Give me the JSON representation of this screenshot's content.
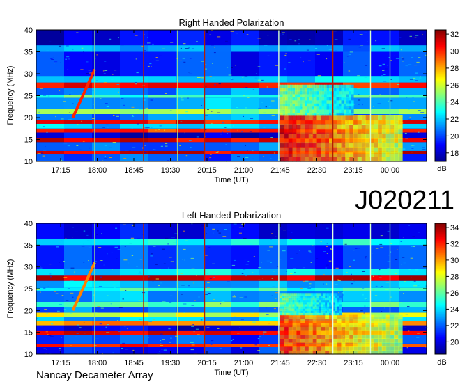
{
  "main_title": "J020211",
  "footer": "Nancay Decameter Array",
  "chart_data": [
    {
      "type": "heatmap",
      "title": "Right Handed Polarization",
      "xlabel": "Time (UT)",
      "ylabel": "Frequency (MHz)",
      "x_ticks": [
        "17:15",
        "18:00",
        "18:45",
        "19:30",
        "20:15",
        "21:00",
        "21:45",
        "22:30",
        "23:15",
        "00:00"
      ],
      "y_ticks": [
        10,
        15,
        20,
        25,
        30,
        35,
        40
      ],
      "ylim": [
        10,
        40
      ],
      "colorbar": {
        "ticks": [
          18,
          20,
          22,
          24,
          26,
          28,
          30,
          32
        ],
        "range": [
          17,
          32.5
        ],
        "label": "dB"
      },
      "bands": [
        {
          "f0": 10.0,
          "f1": 11.6,
          "level": 20.0
        },
        {
          "f0": 11.6,
          "f1": 12.4,
          "level": 31.0
        },
        {
          "f0": 12.4,
          "f1": 14.4,
          "level": 20.5
        },
        {
          "f0": 14.4,
          "f1": 15.3,
          "level": 31.0
        },
        {
          "f0": 15.3,
          "f1": 16.6,
          "level": 18.5
        },
        {
          "f0": 16.6,
          "f1": 17.5,
          "level": 30.0
        },
        {
          "f0": 17.5,
          "f1": 18.6,
          "level": 22.0
        },
        {
          "f0": 18.6,
          "f1": 19.5,
          "level": 30.5
        },
        {
          "f0": 19.5,
          "f1": 20.8,
          "level": 21.0
        },
        {
          "f0": 20.8,
          "f1": 22.0,
          "level": 25.0
        },
        {
          "f0": 22.0,
          "f1": 24.5,
          "level": 21.5
        },
        {
          "f0": 24.5,
          "f1": 25.2,
          "level": 24.0
        },
        {
          "f0": 25.2,
          "f1": 26.8,
          "level": 21.0
        },
        {
          "f0": 26.8,
          "f1": 28.0,
          "level": 30.5
        },
        {
          "f0": 28.0,
          "f1": 29.5,
          "level": 22.0
        },
        {
          "f0": 29.5,
          "f1": 35.0,
          "level": 19.5
        },
        {
          "f0": 35.0,
          "f1": 36.5,
          "level": 21.0
        },
        {
          "f0": 36.5,
          "f1": 40.0,
          "level": 18.5
        }
      ],
      "bursts": [
        {
          "t0": 21.75,
          "t1": 24.25,
          "f0": 10.0,
          "f1": 20.5,
          "level": 30.5
        },
        {
          "t0": 21.75,
          "t1": 23.25,
          "f0": 20.5,
          "f1": 27.5,
          "level": 25.0
        }
      ],
      "drift": {
        "t0": 17.5,
        "t1": 17.95,
        "f_top": 31.0,
        "f_bottom": 20.0,
        "level": 30.0
      },
      "vlines": [
        {
          "t": 17.95,
          "color": "#9be08a"
        },
        {
          "t": 18.95,
          "color": "#b41e00"
        },
        {
          "t": 19.65,
          "color": "#c8ff6a"
        },
        {
          "t": 20.2,
          "color": "#b41e00"
        },
        {
          "t": 21.72,
          "color": "#d6ffd0"
        },
        {
          "t": 22.83,
          "color": "#b41e00"
        },
        {
          "t": 23.6,
          "color": "#d6ffd0"
        },
        {
          "t": 24.0,
          "color": "#7fd9a8"
        }
      ]
    },
    {
      "type": "heatmap",
      "title": "Left Handed Polarization",
      "xlabel": "Time (UT)",
      "ylabel": "Frequency (MHz)",
      "x_ticks": [
        "17:15",
        "18:00",
        "18:45",
        "19:30",
        "20:15",
        "21:00",
        "21:45",
        "22:30",
        "23:15",
        "00:00"
      ],
      "y_ticks": [
        10,
        15,
        20,
        25,
        30,
        35,
        40
      ],
      "ylim": [
        10,
        40
      ],
      "colorbar": {
        "ticks": [
          20,
          22,
          24,
          26,
          28,
          30,
          32,
          34
        ],
        "range": [
          18.5,
          34.5
        ],
        "label": "dB"
      },
      "bands": [
        {
          "f0": 10.0,
          "f1": 11.6,
          "level": 21.0
        },
        {
          "f0": 11.6,
          "f1": 12.4,
          "level": 32.0
        },
        {
          "f0": 12.4,
          "f1": 14.4,
          "level": 21.5
        },
        {
          "f0": 14.4,
          "f1": 15.3,
          "level": 32.5
        },
        {
          "f0": 15.3,
          "f1": 16.6,
          "level": 20.0
        },
        {
          "f0": 16.6,
          "f1": 17.5,
          "level": 30.0
        },
        {
          "f0": 17.5,
          "f1": 18.6,
          "level": 23.5
        },
        {
          "f0": 18.6,
          "f1": 19.5,
          "level": 28.0
        },
        {
          "f0": 19.5,
          "f1": 20.8,
          "level": 22.5
        },
        {
          "f0": 20.8,
          "f1": 22.0,
          "level": 26.0
        },
        {
          "f0": 22.0,
          "f1": 24.5,
          "level": 23.0
        },
        {
          "f0": 24.5,
          "f1": 25.2,
          "level": 25.0
        },
        {
          "f0": 25.2,
          "f1": 26.8,
          "level": 23.5
        },
        {
          "f0": 26.8,
          "f1": 28.0,
          "level": 33.0
        },
        {
          "f0": 28.0,
          "f1": 29.5,
          "level": 24.0
        },
        {
          "f0": 29.5,
          "f1": 35.0,
          "level": 21.5
        },
        {
          "f0": 35.0,
          "f1": 36.5,
          "level": 24.5
        },
        {
          "f0": 36.5,
          "f1": 40.0,
          "level": 20.5
        }
      ],
      "bursts": [
        {
          "t0": 21.75,
          "t1": 24.25,
          "f0": 10.0,
          "f1": 19.0,
          "level": 31.5
        },
        {
          "t0": 21.75,
          "t1": 23.0,
          "f0": 19.0,
          "f1": 24.0,
          "level": 26.0
        }
      ],
      "drift": {
        "t0": 17.5,
        "t1": 17.95,
        "f_top": 31.0,
        "f_bottom": 20.0,
        "level": 30.5
      },
      "vlines": [
        {
          "t": 17.95,
          "color": "#9be08a"
        },
        {
          "t": 18.95,
          "color": "#b41e00"
        },
        {
          "t": 19.65,
          "color": "#c8ff6a"
        },
        {
          "t": 20.2,
          "color": "#b41e00"
        },
        {
          "t": 21.72,
          "color": "#d6ffd0"
        },
        {
          "t": 22.83,
          "color": "#e8ffe0"
        },
        {
          "t": 23.6,
          "color": "#d6ffd0"
        },
        {
          "t": 24.0,
          "color": "#7fd9a8"
        }
      ]
    }
  ]
}
